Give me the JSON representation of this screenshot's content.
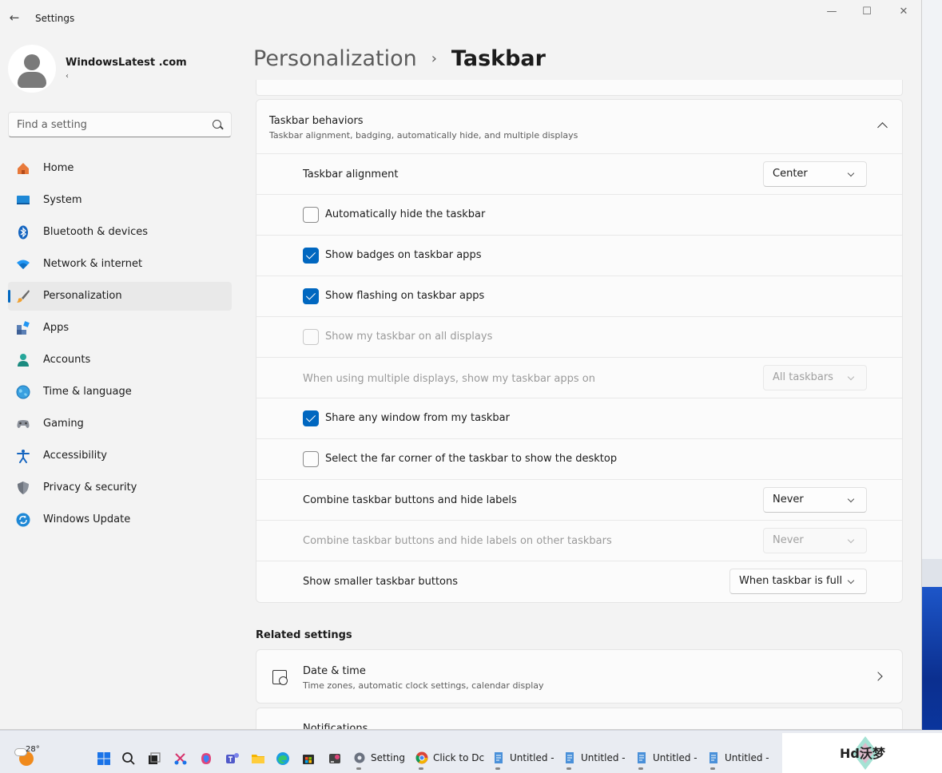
{
  "window": {
    "app_title": "Settings",
    "minimize": "—",
    "maximize": "☐",
    "close": "✕"
  },
  "profile": {
    "name": "WindowsLatest .com",
    "sub": "‹"
  },
  "search": {
    "placeholder": "Find a setting"
  },
  "sidebar": {
    "items": [
      {
        "label": "Home",
        "icon": "home-icon",
        "active": false
      },
      {
        "label": "System",
        "icon": "system-icon",
        "active": false
      },
      {
        "label": "Bluetooth & devices",
        "icon": "bluetooth-icon",
        "active": false
      },
      {
        "label": "Network & internet",
        "icon": "network-icon",
        "active": false
      },
      {
        "label": "Personalization",
        "icon": "brush-icon",
        "active": true
      },
      {
        "label": "Apps",
        "icon": "apps-icon",
        "active": false
      },
      {
        "label": "Accounts",
        "icon": "accounts-icon",
        "active": false
      },
      {
        "label": "Time & language",
        "icon": "globe-icon",
        "active": false
      },
      {
        "label": "Gaming",
        "icon": "gamepad-icon",
        "active": false
      },
      {
        "label": "Accessibility",
        "icon": "accessibility-icon",
        "active": false
      },
      {
        "label": "Privacy & security",
        "icon": "shield-icon",
        "active": false
      },
      {
        "label": "Windows Update",
        "icon": "update-icon",
        "active": false
      }
    ]
  },
  "header": {
    "parent": "Personalization",
    "separator": "›",
    "current": "Taskbar"
  },
  "behaviors": {
    "title": "Taskbar behaviors",
    "description": "Taskbar alignment, badging, automatically hide, and multiple displays",
    "alignment": {
      "label": "Taskbar alignment",
      "value": "Center"
    },
    "auto_hide": {
      "label": "Automatically hide the taskbar",
      "checked": false
    },
    "badges": {
      "label": "Show badges on taskbar apps",
      "checked": true
    },
    "flashing": {
      "label": "Show flashing on taskbar apps",
      "checked": true
    },
    "all_displays": {
      "label": "Show my taskbar on all displays",
      "checked": false,
      "disabled": true
    },
    "multi_display": {
      "label": "When using multiple displays, show my taskbar apps on",
      "value": "All taskbars",
      "disabled": true
    },
    "share_window": {
      "label": "Share any window from my taskbar",
      "checked": true
    },
    "far_corner": {
      "label": "Select the far corner of the taskbar to show the desktop",
      "checked": false
    },
    "combine": {
      "label": "Combine taskbar buttons and hide labels",
      "value": "Never"
    },
    "combine_other": {
      "label": "Combine taskbar buttons and hide labels on other taskbars",
      "value": "Never",
      "disabled": true
    },
    "smaller": {
      "label": "Show smaller taskbar buttons",
      "value": "When taskbar is full"
    }
  },
  "related": {
    "title": "Related settings",
    "date_time": {
      "title": "Date & time",
      "description": "Time zones, automatic clock settings, calendar display"
    },
    "notifications": {
      "title": "Notifications"
    }
  },
  "taskbar": {
    "temperature": "28°",
    "apps": [
      {
        "label": "Setting",
        "icon": "settings-icon"
      },
      {
        "label": "Click to Dc",
        "icon": "chrome-icon"
      },
      {
        "label": "Untitled -",
        "icon": "notepad-icon"
      },
      {
        "label": "Untitled -",
        "icon": "notepad-icon"
      },
      {
        "label": "Untitled -",
        "icon": "notepad-icon"
      },
      {
        "label": "Untitled -",
        "icon": "notepad-icon"
      }
    ]
  },
  "watermark": {
    "text": "Hd沃梦"
  }
}
